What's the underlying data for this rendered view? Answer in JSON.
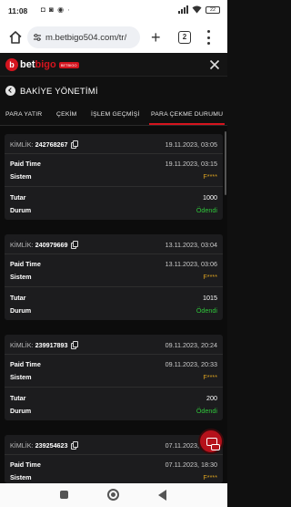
{
  "status_bar": {
    "time": "11:08",
    "system_icons": "◘ ◙ ◉ ∙",
    "battery": "22"
  },
  "browser": {
    "url": "m.betbigo504.com/tr/",
    "tab_count": "2"
  },
  "app": {
    "logo_prefix": "bet",
    "logo_suffix": "bigo",
    "logo_tag": "BETBIGO",
    "logo_mark": "b"
  },
  "section": {
    "title": "BAKİYE YÖNETİMİ"
  },
  "tabs": [
    {
      "label": "PARA YATIR",
      "active": false
    },
    {
      "label": "ÇEKİM",
      "active": false
    },
    {
      "label": "İŞLEM GEÇMİŞİ",
      "active": false
    },
    {
      "label": "PARA ÇEKME DURUMU",
      "active": true
    }
  ],
  "labels": {
    "kimlik": "KİMLİK:",
    "paid_time": "Paid Time",
    "sistem": "Sistem",
    "tutar": "Tutar",
    "durum": "Durum"
  },
  "transactions": [
    {
      "id": "242768267",
      "date": "19.11.2023, 03:05",
      "paid_time": "19.11.2023, 03:15",
      "system": "F****",
      "amount": "1000",
      "status": "Ödendi"
    },
    {
      "id": "240979669",
      "date": "13.11.2023, 03:04",
      "paid_time": "13.11.2023, 03:06",
      "system": "F****",
      "amount": "1015",
      "status": "Ödendi"
    },
    {
      "id": "239917893",
      "date": "09.11.2023, 20:24",
      "paid_time": "09.11.2023, 20:33",
      "system": "F****",
      "amount": "200",
      "status": "Ödendi"
    },
    {
      "id": "239254623",
      "date": "07.11.2023, 18:22",
      "paid_time": "07.11.2023, 18:30",
      "system": "F****",
      "amount": "",
      "status": ""
    }
  ],
  "colors": {
    "brand_red": "#d4141e",
    "status_paid": "#2fc33a",
    "system_gold": "#d8a020",
    "background": "#101010"
  }
}
